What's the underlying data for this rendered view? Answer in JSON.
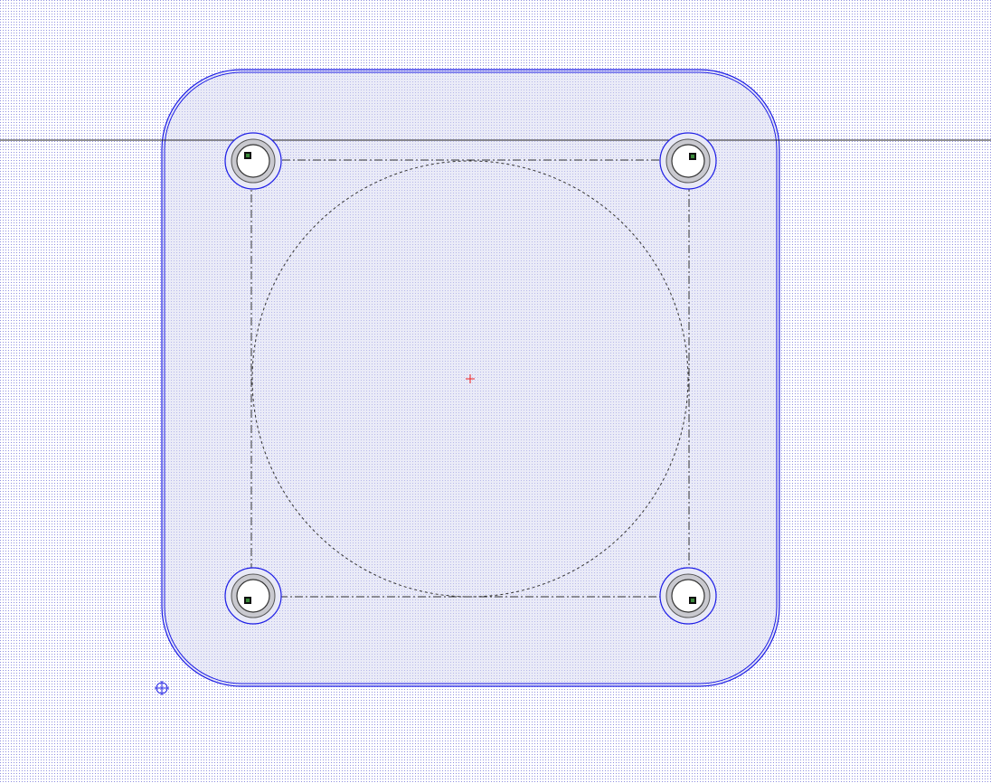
{
  "canvas": {
    "background": "#ffffff",
    "grid_dot_color": "#6a6ad6",
    "plate_fill": "#e8e9f6",
    "outline_color": "#1e1ee6",
    "construction_color": "#333333",
    "origin_color": "#ee2222"
  },
  "elements": {
    "plate": "rounded-square-plate",
    "bore_circle": "dashed-construction-circle",
    "bolt_pattern": "dashed-construction-square",
    "mounting_holes": [
      "top-left",
      "top-right",
      "bottom-left",
      "bottom-right"
    ],
    "origin_marker": "red-cross-icon",
    "reference_marker": "crosshair-circle-icon",
    "reference_line": "horizontal-guide-line"
  }
}
